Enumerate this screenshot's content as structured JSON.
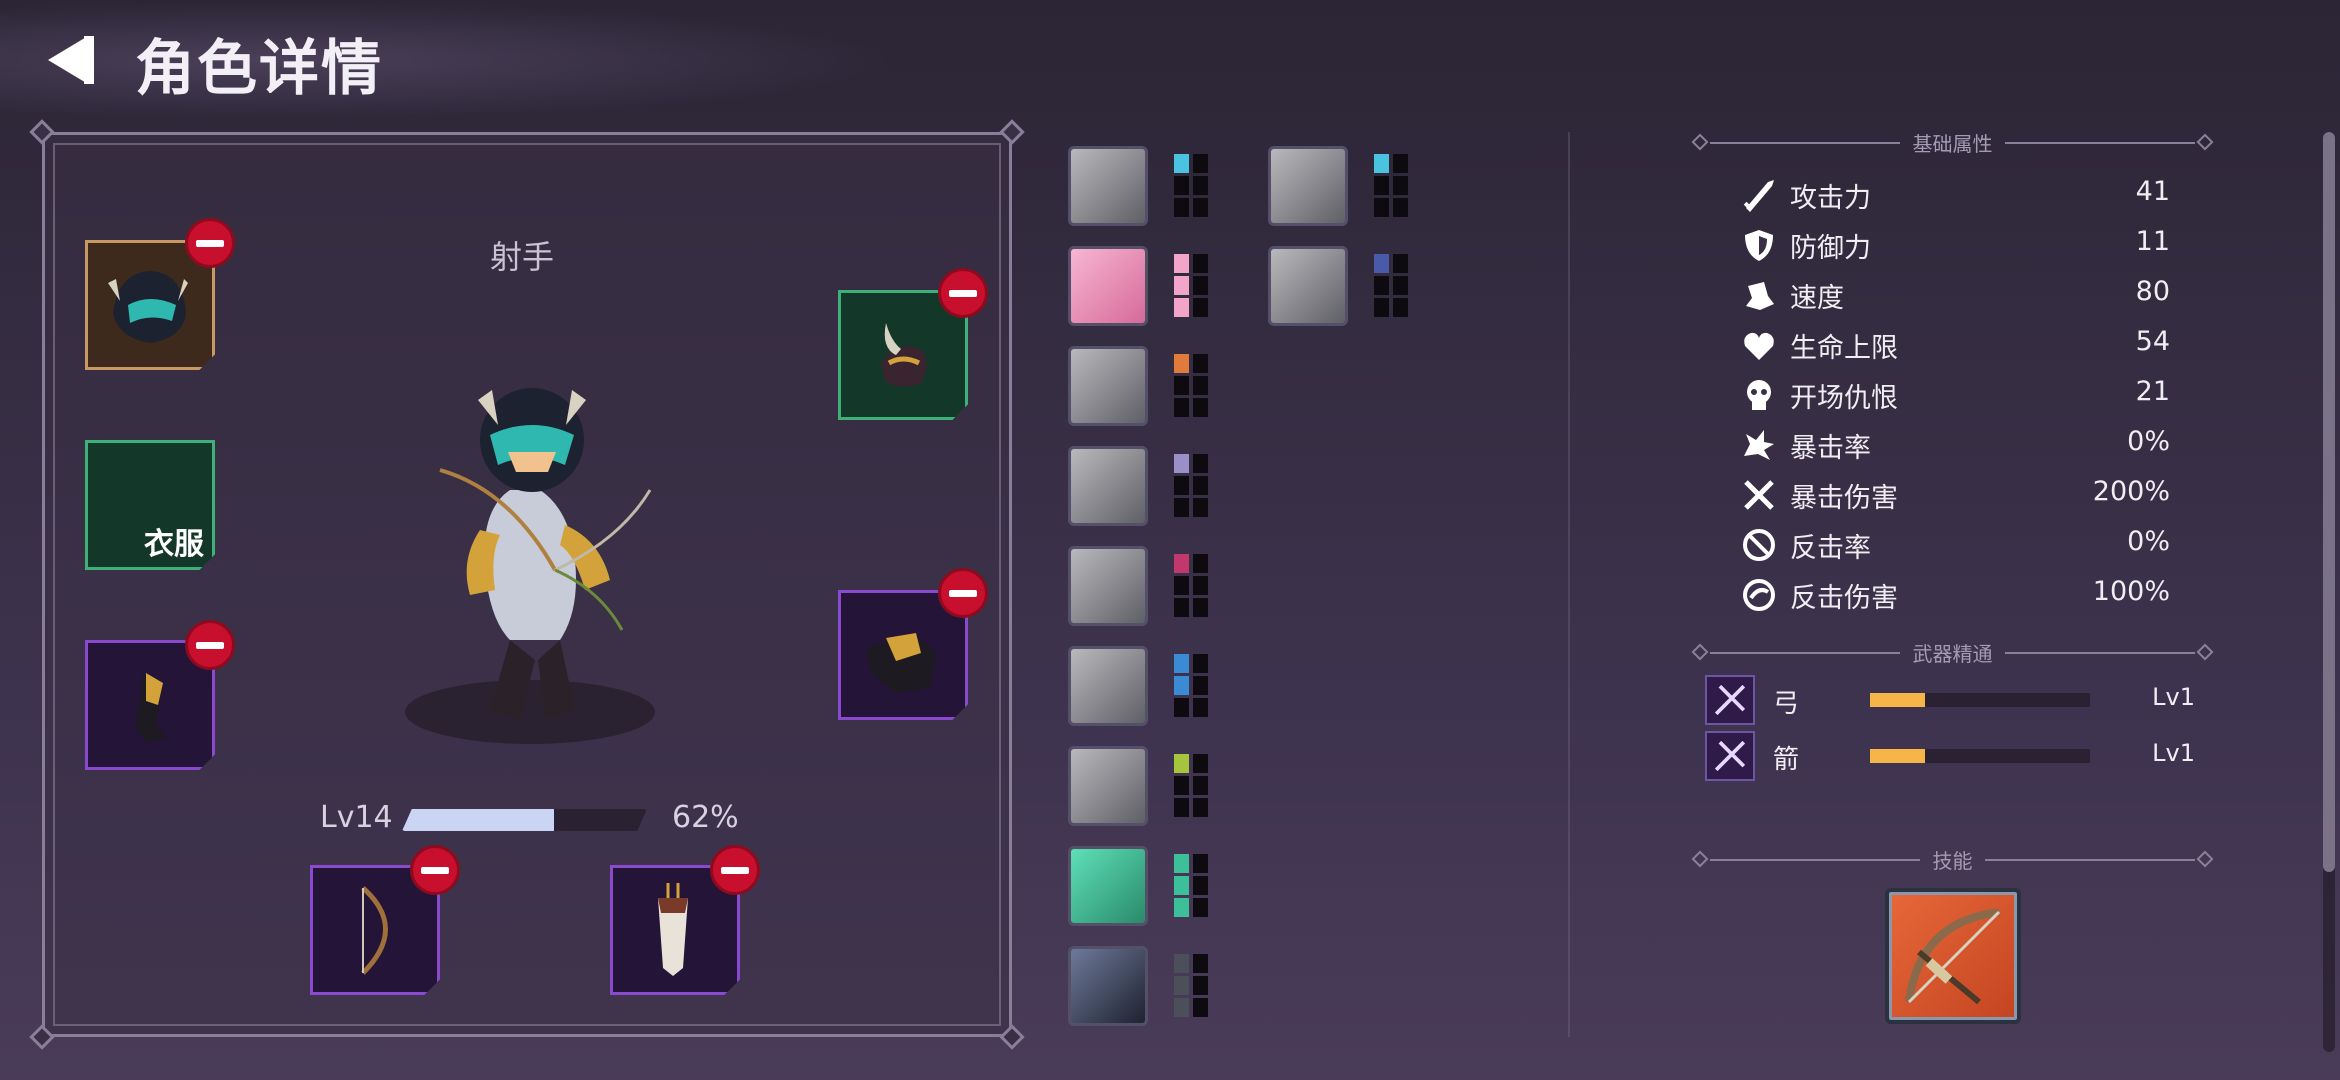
{
  "header": {
    "title": "角色详情"
  },
  "character": {
    "class_name": "射手",
    "level_label": "Lv14",
    "progress": 0.62,
    "progress_label": "62%",
    "slots": {
      "armor_label": "衣服"
    }
  },
  "traits": {
    "col1": [
      {
        "icon": "stone-fist-icon",
        "color": "#49c3e0",
        "pips": 1
      },
      {
        "icon": "boot-icon",
        "color": "#f2a5c8",
        "pips": 3
      },
      {
        "icon": "rain-figure-icon",
        "color": "#e07b3c",
        "pips": 1
      },
      {
        "icon": "knight-icon",
        "color": "#9a8fc6",
        "pips": 1
      },
      {
        "icon": "claw-slash-icon",
        "color": "#c0386c",
        "pips": 1
      },
      {
        "icon": "brawler-icon",
        "color": "#3a8ad6",
        "pips": 2
      },
      {
        "icon": "hooded-head-icon",
        "color": "#a6c43c",
        "pips": 1
      },
      {
        "icon": "goblin-face-icon",
        "color": "#3dbf9a",
        "pips": 3
      },
      {
        "icon": "lightning-orb-icon",
        "color": "#4a4f5a",
        "pips": 3
      }
    ],
    "col2": [
      {
        "icon": "flame-spirit-icon",
        "color": "#49c3e0",
        "pips": 1
      },
      {
        "icon": "stone-claw-icon",
        "color": "#4a5aa8",
        "pips": 1
      }
    ]
  },
  "stats": {
    "section_title": "基础属性",
    "rows": [
      {
        "icon": "sword-icon",
        "name": "攻击力",
        "value": "41"
      },
      {
        "icon": "shield-icon",
        "name": "防御力",
        "value": "11"
      },
      {
        "icon": "boot-speed-icon",
        "name": "速度",
        "value": "80"
      },
      {
        "icon": "heart-icon",
        "name": "生命上限",
        "value": "54"
      },
      {
        "icon": "skull-icon",
        "name": "开场仇恨",
        "value": "21"
      },
      {
        "icon": "crit-burst-icon",
        "name": "暴击率",
        "value": "0%"
      },
      {
        "icon": "crossed-swords-icon",
        "name": "暴击伤害",
        "value": "200%"
      },
      {
        "icon": "counter-icon",
        "name": "反击率",
        "value": "0%"
      },
      {
        "icon": "counter-damage-icon",
        "name": "反击伤害",
        "value": "100%"
      }
    ]
  },
  "mastery": {
    "section_title": "武器精通",
    "rows": [
      {
        "icon": "bow-mastery-icon",
        "name": "弓",
        "progress": 0.25,
        "level": "Lv1"
      },
      {
        "icon": "arrow-mastery-icon",
        "name": "箭",
        "progress": 0.25,
        "level": "Lv1"
      }
    ]
  },
  "skills": {
    "section_title": "技能"
  },
  "colors": {
    "accent_bar": "#f5b548",
    "remove": "#c8102e",
    "xp_fill": "#c9d5f2"
  }
}
